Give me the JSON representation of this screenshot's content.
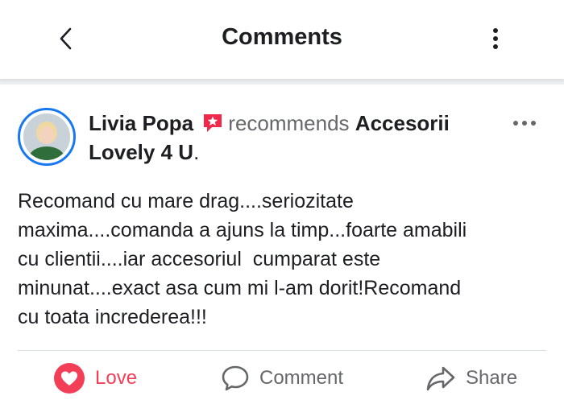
{
  "header": {
    "title": "Comments"
  },
  "post": {
    "author": "Livia Popa",
    "verb": "recommends",
    "page_name": "Accesorii Lovely 4 U",
    "page_suffix": ".",
    "text": "Recomand cu mare drag....seriozitate\nmaxima....comanda a ajuns la timp...foarte amabili\ncu clientii....iar accesoriul  cumparat este\nminunat....exact asa cum mi l-am dorit!Recomand\ncu toata increderea!!!"
  },
  "actions": {
    "love_label": "Love",
    "comment_label": "Comment",
    "share_label": "Share"
  },
  "colors": {
    "love": "#f33e58",
    "accent": "#1877f2",
    "muted": "#65676b"
  },
  "icons": [
    "back-arrow-icon",
    "more-vertical-icon",
    "star-badge-icon",
    "more-horizontal-icon",
    "heart-icon",
    "comment-bubble-icon",
    "share-arrow-icon"
  ]
}
